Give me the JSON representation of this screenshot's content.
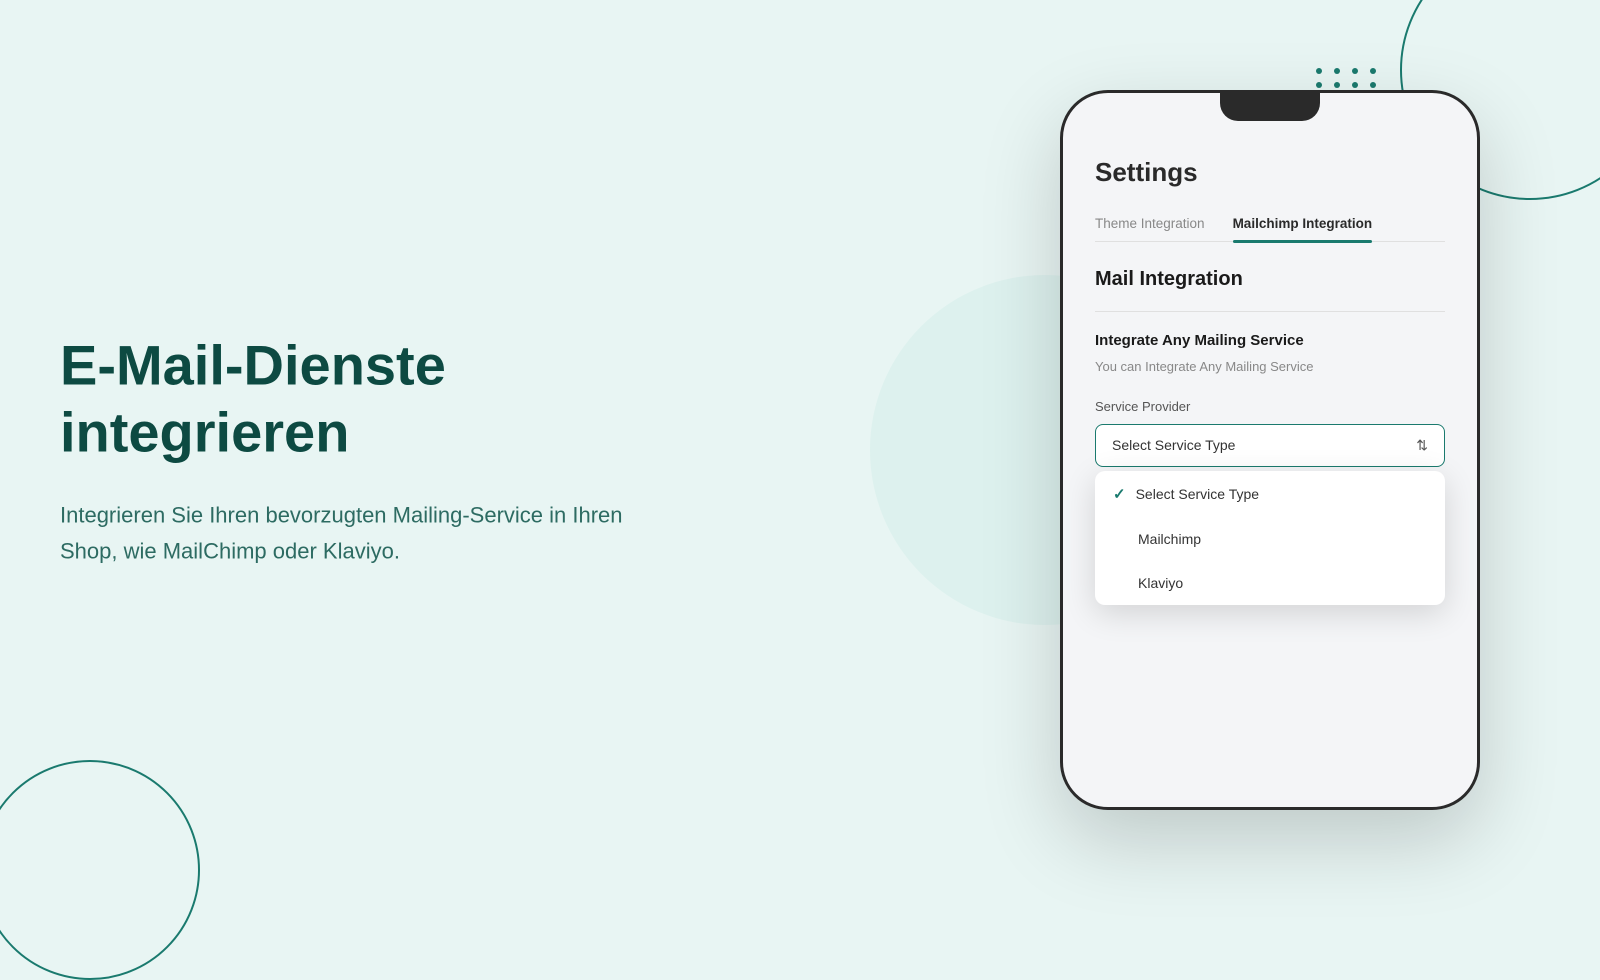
{
  "background": {
    "color": "#e8f5f3"
  },
  "left": {
    "title_line1": "E-Mail-Dienste",
    "title_line2": "integrieren",
    "subtitle": "Integrieren Sie Ihren bevorzugten Mailing-Service in Ihren Shop, wie MailChimp oder Klaviyo."
  },
  "phone": {
    "settings_title": "Settings",
    "tabs": [
      {
        "label": "Theme Integration",
        "active": false
      },
      {
        "label": "Mailchimp Integration",
        "active": true
      }
    ],
    "section_title": "Mail Integration",
    "integrate_title": "Integrate Any Mailing Service",
    "integrate_desc": "You can Integrate Any Mailing Service",
    "service_provider_label": "Service Provider",
    "select_placeholder": "Select Service Type",
    "dropdown_items": [
      {
        "label": "Select Service Type",
        "checked": true
      },
      {
        "label": "Mailchimp",
        "checked": false
      },
      {
        "label": "Klaviyo",
        "checked": false
      }
    ]
  },
  "icons": {
    "check": "✓",
    "arrows": "⇅"
  }
}
